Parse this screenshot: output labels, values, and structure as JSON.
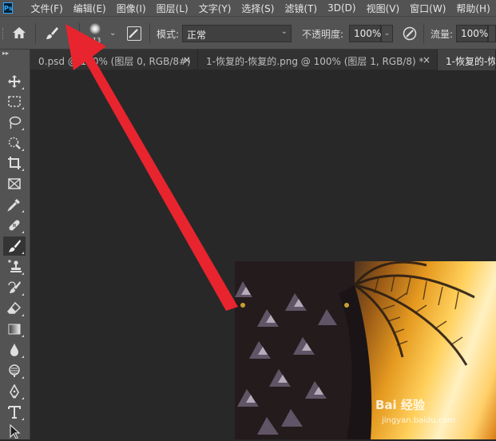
{
  "app": {
    "logo_text": "Ps"
  },
  "menu": [
    {
      "label": "文件(F)"
    },
    {
      "label": "编辑(E)"
    },
    {
      "label": "图像(I)"
    },
    {
      "label": "图层(L)"
    },
    {
      "label": "文字(Y)"
    },
    {
      "label": "选择(S)"
    },
    {
      "label": "滤镜(T)"
    },
    {
      "label": "3D(D)"
    },
    {
      "label": "视图(V)"
    },
    {
      "label": "窗口(W)"
    },
    {
      "label": "帮助(H)"
    }
  ],
  "options": {
    "brush_size": "13",
    "mode_label": "模式:",
    "mode_value": "正常",
    "opacity_label": "不透明度:",
    "opacity_value": "100%",
    "flow_label": "流量:",
    "flow_value": "100%"
  },
  "tabs": [
    {
      "label": "0.psd @ 100% (图层 0, RGB/8#)",
      "close": "×"
    },
    {
      "label": "1-恢复的-恢复的.png @ 100% (图层 1, RGB/8) *",
      "close": "×"
    },
    {
      "label": "1-恢复的-恢",
      "close": ""
    }
  ],
  "tools": [
    {
      "name": "move-tool-icon"
    },
    {
      "name": "marquee-tool-icon"
    },
    {
      "name": "lasso-tool-icon"
    },
    {
      "name": "quick-selection-tool-icon"
    },
    {
      "name": "crop-tool-icon"
    },
    {
      "name": "frame-tool-icon"
    },
    {
      "name": "eyedropper-tool-icon"
    },
    {
      "name": "healing-brush-tool-icon"
    },
    {
      "name": "brush-tool-icon",
      "active": true
    },
    {
      "name": "clone-stamp-tool-icon"
    },
    {
      "name": "history-brush-tool-icon"
    },
    {
      "name": "eraser-tool-icon"
    },
    {
      "name": "gradient-tool-icon"
    },
    {
      "name": "blur-tool-icon"
    },
    {
      "name": "dodge-tool-icon"
    },
    {
      "name": "pen-tool-icon"
    },
    {
      "name": "type-tool-icon"
    },
    {
      "name": "path-selection-tool-icon"
    }
  ],
  "annotation": {
    "color": "#e8242e"
  },
  "watermark": {
    "text": "Bai 经验",
    "sub": "jingyan.baidu.com"
  },
  "colors": {
    "accent": "#31a8ff",
    "ui_bg": "#535353",
    "canvas_bg": "#282828"
  }
}
